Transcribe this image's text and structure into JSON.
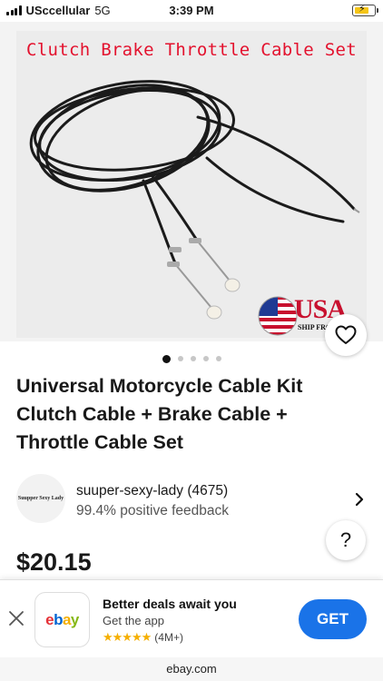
{
  "status_bar": {
    "carrier": "USccellular",
    "network": "5G",
    "time": "3:39 PM"
  },
  "product_image": {
    "overlay_title": "Clutch Brake Throttle Cable Set",
    "badge_text": "USA",
    "badge_subtext": "SHIP FROM",
    "carousel": {
      "total": 5,
      "active_index": 0
    }
  },
  "item": {
    "title": "Universal Motorcycle Cable Kit Clutch Cable + Brake Cable + Throttle Cable Set",
    "price": "$20.15"
  },
  "seller": {
    "avatar_text": "Suupper Sexy Lady",
    "name": "suuper-sexy-lady (4675)",
    "feedback": "99.4% positive feedback"
  },
  "help_label": "?",
  "app_banner": {
    "logo": [
      "e",
      "b",
      "a",
      "y"
    ],
    "title": "Better deals await you",
    "subtitle": "Get the app",
    "stars": "★★★★★",
    "rating_count": "(4M+)",
    "cta": "GET"
  },
  "url": "ebay.com",
  "colors": {
    "accent_blue": "#1a73e8",
    "overlay_red": "#e3122e",
    "star_gold": "#f5af02"
  }
}
